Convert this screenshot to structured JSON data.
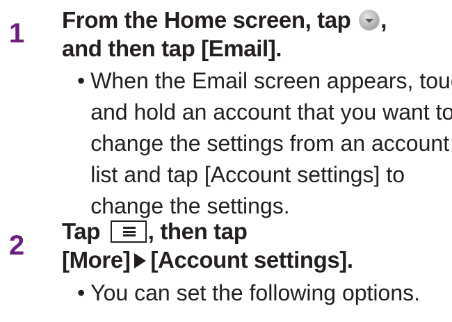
{
  "steps": [
    {
      "number": "1",
      "title_line1_before_icon": "From the Home screen, tap ",
      "title_line1_after_icon": ",",
      "title_line2": "and then tap [Email].",
      "icon": "home-menu-icon",
      "bullets": [
        {
          "marker": "•",
          "lines": [
            "When the Email screen appears, touch",
            "and hold an account that you want to",
            "change the settings from an account",
            "list and tap [Account settings] to",
            "change the settings."
          ]
        }
      ]
    },
    {
      "number": "2",
      "title_line1_before_key": "Tap ",
      "title_line1_after_key": ", then tap",
      "title_line2_part1": "[More]",
      "title_line2_part2": "[Account settings].",
      "key_icon": "menu-key-icon",
      "arrow_icon": "right-triangle-icon",
      "bullets": [
        {
          "marker": "•",
          "lines": [
            "You can set the following options."
          ]
        }
      ]
    }
  ],
  "colors": {
    "step_number": "#6a1f80",
    "text": "#231f20"
  }
}
